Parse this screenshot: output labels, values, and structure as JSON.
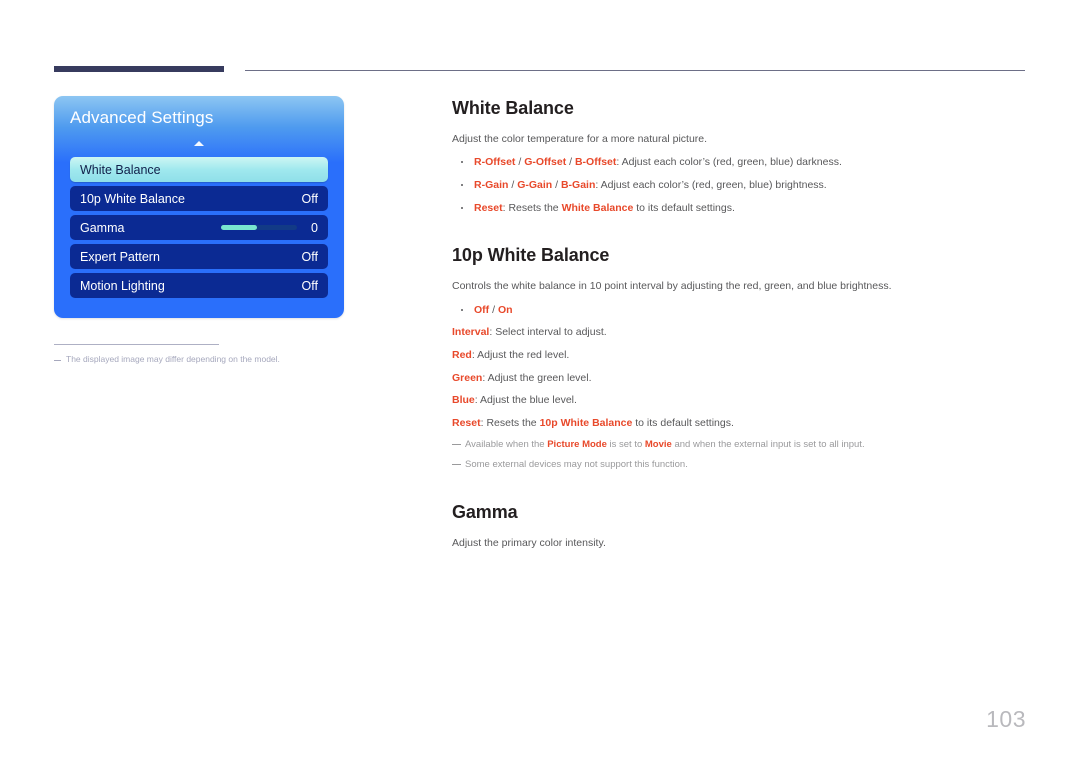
{
  "colors": {
    "accent_red": "#e8492b",
    "rule_navy": "#373b5e",
    "osd_blue": "#2a6ffb",
    "osd_row_blue": "#0b2a93",
    "osd_selected_cyan": "#9fe8ee",
    "slider_fill": "#79e6cf",
    "body_gray": "#58585a",
    "note_gray": "#9a9a9c",
    "page_number_gray": "#b9b9bd"
  },
  "osd": {
    "title": "Advanced Settings",
    "scroll_arrow_icon": "chevron-up-icon",
    "rows": [
      {
        "label": "White Balance",
        "value": "",
        "selected": true,
        "type": "item"
      },
      {
        "label": "10p White Balance",
        "value": "Off",
        "selected": false,
        "type": "item"
      },
      {
        "label": "Gamma",
        "value": "0",
        "selected": false,
        "type": "slider",
        "slider_percent": 47
      },
      {
        "label": "Expert Pattern",
        "value": "Off",
        "selected": false,
        "type": "item"
      },
      {
        "label": "Motion Lighting",
        "value": "Off",
        "selected": false,
        "type": "item"
      }
    ]
  },
  "footnote": {
    "text": "The displayed image may differ depending on the model."
  },
  "content": {
    "white_balance": {
      "title": "White Balance",
      "lead": "Adjust the color temperature for a more natural picture.",
      "bullets": [
        {
          "parts": [
            {
              "t": "R-Offset",
              "style": "red"
            },
            {
              "t": " / ",
              "style": "sep"
            },
            {
              "t": "G-Offset",
              "style": "red"
            },
            {
              "t": " / ",
              "style": "sep"
            },
            {
              "t": "B-Offset",
              "style": "red"
            },
            {
              "t": ": Adjust each color’s (red, green, blue) darkness.",
              "style": "plain"
            }
          ]
        },
        {
          "parts": [
            {
              "t": "R-Gain",
              "style": "red"
            },
            {
              "t": " / ",
              "style": "sep"
            },
            {
              "t": "G-Gain",
              "style": "red"
            },
            {
              "t": " / ",
              "style": "sep"
            },
            {
              "t": "B-Gain",
              "style": "red"
            },
            {
              "t": ": Adjust each color’s (red, green, blue) brightness.",
              "style": "plain"
            }
          ]
        },
        {
          "parts": [
            {
              "t": "Reset",
              "style": "red"
            },
            {
              "t": ": Resets the ",
              "style": "plain"
            },
            {
              "t": "White Balance",
              "style": "red"
            },
            {
              "t": " to its default settings.",
              "style": "plain"
            }
          ]
        }
      ]
    },
    "ten_p_white_balance": {
      "title": "10p White Balance",
      "lead": "Controls the white balance in 10 point interval by adjusting the red, green, and blue brightness.",
      "bullets": [
        {
          "parts": [
            {
              "t": "Off",
              "style": "red"
            },
            {
              "t": " / ",
              "style": "sep"
            },
            {
              "t": "On",
              "style": "red"
            }
          ]
        }
      ],
      "termlines": [
        {
          "parts": [
            {
              "t": "Interval",
              "style": "red"
            },
            {
              "t": ": Select interval to adjust.",
              "style": "plain"
            }
          ]
        },
        {
          "parts": [
            {
              "t": "Red",
              "style": "red"
            },
            {
              "t": ": Adjust the red level.",
              "style": "plain"
            }
          ]
        },
        {
          "parts": [
            {
              "t": "Green",
              "style": "red"
            },
            {
              "t": ": Adjust the green level.",
              "style": "plain"
            }
          ]
        },
        {
          "parts": [
            {
              "t": "Blue",
              "style": "red"
            },
            {
              "t": ": Adjust the blue level.",
              "style": "plain"
            }
          ]
        },
        {
          "parts": [
            {
              "t": "Reset",
              "style": "red"
            },
            {
              "t": ": Resets the ",
              "style": "plain"
            },
            {
              "t": "10p White Balance",
              "style": "red"
            },
            {
              "t": " to its default settings.",
              "style": "plain"
            }
          ]
        }
      ],
      "notes": [
        {
          "parts": [
            {
              "t": "Available when the ",
              "style": "plain"
            },
            {
              "t": "Picture Mode",
              "style": "red"
            },
            {
              "t": " is set to ",
              "style": "plain"
            },
            {
              "t": "Movie",
              "style": "red"
            },
            {
              "t": " and when the external input is set to all input.",
              "style": "plain"
            }
          ]
        },
        {
          "parts": [
            {
              "t": "Some external devices may not support this function.",
              "style": "plain"
            }
          ]
        }
      ]
    },
    "gamma": {
      "title": "Gamma",
      "lead": "Adjust the primary color intensity."
    }
  },
  "page_number": "103"
}
